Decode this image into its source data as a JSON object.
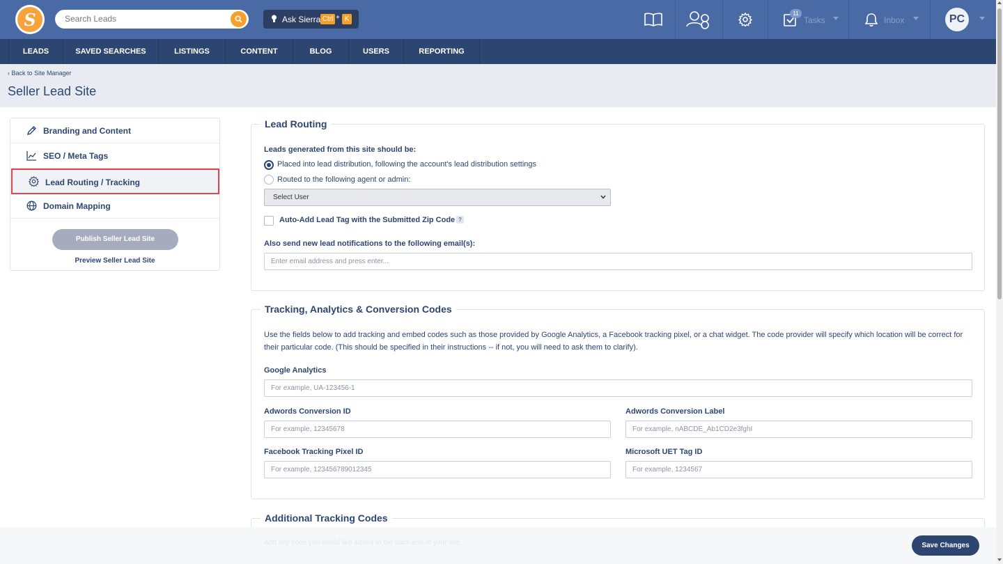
{
  "topbar": {
    "search_placeholder": "Search Leads",
    "ask_label": "Ask Sierra",
    "ask_key1": "Ctrl",
    "ask_plus": "+",
    "ask_key2": "K",
    "tasks_label": "Tasks",
    "tasks_count": "11",
    "inbox_label": "Inbox",
    "avatar_initials": "PC",
    "logo_letter": "S"
  },
  "nav": {
    "items": [
      "LEADS",
      "SAVED SEARCHES",
      "LISTINGS",
      "CONTENT",
      "BLOG",
      "USERS",
      "REPORTING"
    ]
  },
  "header": {
    "back_link": "Back to Site Manager",
    "title": "Seller Lead Site"
  },
  "sidebar": {
    "items": [
      {
        "label": "Branding and Content",
        "icon": "pencil-icon"
      },
      {
        "label": "SEO / Meta Tags",
        "icon": "chart-line-icon"
      },
      {
        "label": "Lead Routing / Tracking",
        "icon": "gear-icon",
        "active": true
      },
      {
        "label": "Domain Mapping",
        "icon": "globe-icon"
      }
    ],
    "publish_button": "Publish Seller Lead Site",
    "preview_link": "Preview Seller Lead Site"
  },
  "lead_routing": {
    "legend": "Lead Routing",
    "question": "Leads generated from this site should be:",
    "option1": "Placed into lead distribution, following the account's lead distribution settings",
    "option2": "Routed to the following agent or admin:",
    "select_user": "Select User",
    "auto_tag_label": "Auto-Add Lead Tag with the Submitted Zip Code",
    "help": "?",
    "emails_label": "Also send new lead notifications to the following email(s):",
    "emails_placeholder": "Enter email address and press enter..."
  },
  "tracking": {
    "legend": "Tracking, Analytics & Conversion Codes",
    "description_line1": "Use the fields below to add tracking and embed codes such as those provided by Google Analytics, a Facebook tracking pixel, or a chat widget. The code provider will specify which location will be correct for",
    "description_line2": "their particular code. (This should be specified in their instructions -- if not, you will need to ask them to clarify).",
    "ga_label": "Google Analytics",
    "ga_placeholder": "For example, UA-123456-1",
    "adwords_id_label": "Adwords Conversion ID",
    "adwords_id_placeholder": "For example, 12345678",
    "adwords_label_label": "Adwords Conversion Label",
    "adwords_label_placeholder": "For example, nABCDE_Ab1CD2e3fghI",
    "fb_label": "Facebook Tracking Pixel ID",
    "fb_placeholder": "For example, 123456789012345",
    "uet_label": "Microsoft UET Tag ID",
    "uet_placeholder": "For example, 1234567"
  },
  "additional": {
    "legend": "Additional Tracking Codes",
    "hint": "Add any code you would like added to the back-end of your site."
  },
  "footer": {
    "save_button": "Save Changes"
  },
  "colors": {
    "topbar": "#4a6aa5",
    "nav": "#2d4671",
    "accent": "#f5a028",
    "highlight": "#e0464e"
  }
}
